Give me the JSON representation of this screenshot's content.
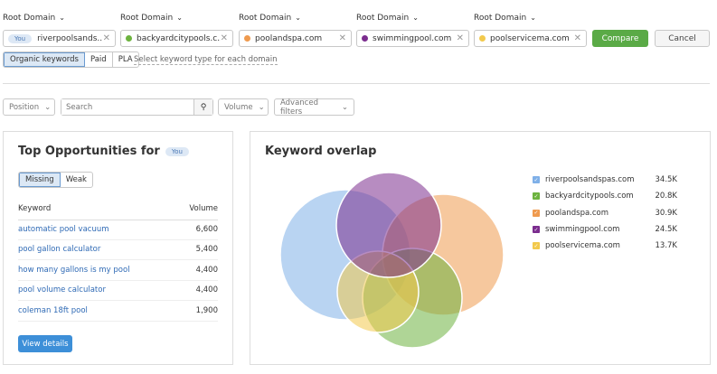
{
  "domains": [
    {
      "label": "Root Domain",
      "value": "riverpoolsands...",
      "badge": "You",
      "color": "#4a78b5"
    },
    {
      "label": "Root Domain",
      "value": "backyardcitypools.c...",
      "color": "#6db33f"
    },
    {
      "label": "Root Domain",
      "value": "poolandspa.com",
      "color": "#ef9a4e"
    },
    {
      "label": "Root Domain",
      "value": "swimmingpool.com",
      "color": "#7b2d8e"
    },
    {
      "label": "Root Domain",
      "value": "poolservicema.com",
      "color": "#f2c94c"
    }
  ],
  "compare_label": "Compare",
  "cancel_label": "Cancel",
  "kw_types": [
    "Organic keywords",
    "Paid",
    "PLA"
  ],
  "kw_type_hint": "Select keyword type for each domain",
  "filters": {
    "position": "Position",
    "search_placeholder": "Search",
    "volume": "Volume",
    "advanced": "Advanced filters"
  },
  "opps": {
    "title": "Top Opportunities for",
    "badge": "You",
    "tabs": [
      "Missing",
      "Weak"
    ],
    "col_keyword": "Keyword",
    "col_volume": "Volume",
    "rows": [
      {
        "k": "automatic pool vacuum",
        "v": "6,600"
      },
      {
        "k": "pool gallon calculator",
        "v": "5,400"
      },
      {
        "k": "how many gallons is my pool",
        "v": "4,400"
      },
      {
        "k": "pool volume calculator",
        "v": "4,400"
      },
      {
        "k": "coleman 18ft pool",
        "v": "1,900"
      }
    ],
    "view_details": "View details"
  },
  "overlap": {
    "title": "Keyword overlap",
    "legend": [
      {
        "domain": "riverpoolsandspas.com",
        "count": "34.5K",
        "color": "#7fb0e8"
      },
      {
        "domain": "backyardcitypools.com",
        "count": "20.8K",
        "color": "#6db33f"
      },
      {
        "domain": "poolandspa.com",
        "count": "30.9K",
        "color": "#ef9a4e"
      },
      {
        "domain": "swimmingpool.com",
        "count": "24.5K",
        "color": "#7b2d8e"
      },
      {
        "domain": "poolservicema.com",
        "count": "13.7K",
        "color": "#f2c94c"
      }
    ]
  }
}
